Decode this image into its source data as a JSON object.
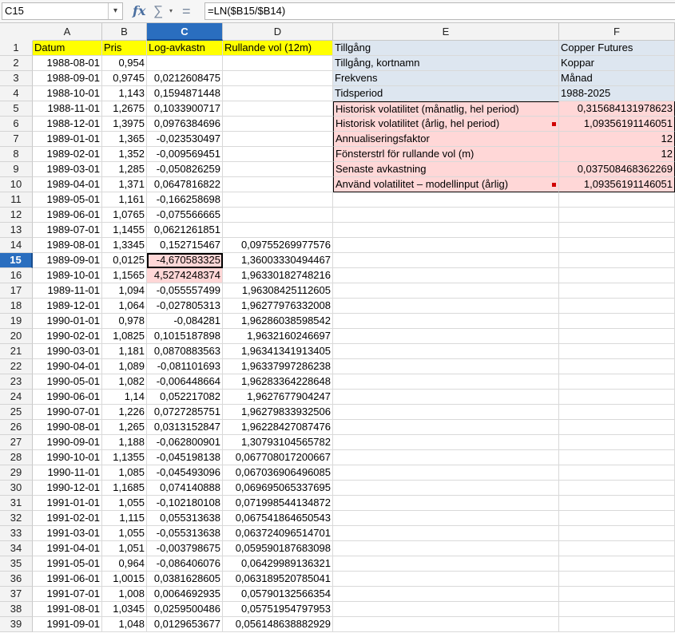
{
  "formula_bar": {
    "cell_ref": "C15",
    "formula": "=LN($B15/$B14)",
    "fx_icon": "fx",
    "sum_icon": "∑",
    "equals_icon": "="
  },
  "columns": [
    "A",
    "B",
    "C",
    "D",
    "E",
    "F"
  ],
  "selected_column": "C",
  "selected_row": "15",
  "header_row": {
    "A": "Datum",
    "B": "Pris",
    "C": "Log-avkastn",
    "D": "Rullande vol (12m)"
  },
  "info": [
    {
      "label": "Tillgång",
      "value": "Copper Futures"
    },
    {
      "label": "Tillgång, kortnamn",
      "value": "Koppar"
    },
    {
      "label": "Frekvens",
      "value": "Månad"
    },
    {
      "label": "Tidsperiod",
      "value": "1988-2025"
    },
    {
      "label": "Historisk volatilitet (månatlig, hel period)",
      "value": "0,315684131978623"
    },
    {
      "label": "Historisk volatilitet (årlig, hel period)",
      "value": "1,09356191146051"
    },
    {
      "label": "Annualiseringsfaktor",
      "value": "12"
    },
    {
      "label": "Fönsterstrl för rullande vol (m)",
      "value": "12"
    },
    {
      "label": "Senaste avkastning",
      "value": "0,037508468362269"
    },
    {
      "label": "Använd volatilitet – modellinput (årlig)",
      "value": "1,09356191146051"
    }
  ],
  "rows": [
    {
      "n": "2",
      "date": "1988-08-01",
      "price": "0,954",
      "ret": "",
      "vol": ""
    },
    {
      "n": "3",
      "date": "1988-09-01",
      "price": "0,9745",
      "ret": "0,0212608475",
      "vol": ""
    },
    {
      "n": "4",
      "date": "1988-10-01",
      "price": "1,143",
      "ret": "0,1594871448",
      "vol": ""
    },
    {
      "n": "5",
      "date": "1988-11-01",
      "price": "1,2675",
      "ret": "0,1033900717",
      "vol": ""
    },
    {
      "n": "6",
      "date": "1988-12-01",
      "price": "1,3975",
      "ret": "0,0976384696",
      "vol": ""
    },
    {
      "n": "7",
      "date": "1989-01-01",
      "price": "1,365",
      "ret": "-0,023530497",
      "vol": ""
    },
    {
      "n": "8",
      "date": "1989-02-01",
      "price": "1,352",
      "ret": "-0,009569451",
      "vol": ""
    },
    {
      "n": "9",
      "date": "1989-03-01",
      "price": "1,285",
      "ret": "-0,050826259",
      "vol": ""
    },
    {
      "n": "10",
      "date": "1989-04-01",
      "price": "1,371",
      "ret": "0,0647816822",
      "vol": ""
    },
    {
      "n": "11",
      "date": "1989-05-01",
      "price": "1,161",
      "ret": "-0,166258698",
      "vol": ""
    },
    {
      "n": "12",
      "date": "1989-06-01",
      "price": "1,0765",
      "ret": "-0,075566665",
      "vol": ""
    },
    {
      "n": "13",
      "date": "1989-07-01",
      "price": "1,1455",
      "ret": "0,0621261851",
      "vol": ""
    },
    {
      "n": "14",
      "date": "1989-08-01",
      "price": "1,3345",
      "ret": "0,152715467",
      "vol": "0,09755269977576"
    },
    {
      "n": "15",
      "date": "1989-09-01",
      "price": "0,0125",
      "ret": "-4,670583325",
      "vol": "1,36003330494467"
    },
    {
      "n": "16",
      "date": "1989-10-01",
      "price": "1,1565",
      "ret": "4,5274248374",
      "vol": "1,96330182748216"
    },
    {
      "n": "17",
      "date": "1989-11-01",
      "price": "1,094",
      "ret": "-0,055557499",
      "vol": "1,96308425112605"
    },
    {
      "n": "18",
      "date": "1989-12-01",
      "price": "1,064",
      "ret": "-0,027805313",
      "vol": "1,96277976332008"
    },
    {
      "n": "19",
      "date": "1990-01-01",
      "price": "0,978",
      "ret": "-0,084281",
      "vol": "1,96286038598542"
    },
    {
      "n": "20",
      "date": "1990-02-01",
      "price": "1,0825",
      "ret": "0,1015187898",
      "vol": "1,9632160246697"
    },
    {
      "n": "21",
      "date": "1990-03-01",
      "price": "1,181",
      "ret": "0,0870883563",
      "vol": "1,96341341913405"
    },
    {
      "n": "22",
      "date": "1990-04-01",
      "price": "1,089",
      "ret": "-0,081101693",
      "vol": "1,96337997286238"
    },
    {
      "n": "23",
      "date": "1990-05-01",
      "price": "1,082",
      "ret": "-0,006448664",
      "vol": "1,96283364228648"
    },
    {
      "n": "24",
      "date": "1990-06-01",
      "price": "1,14",
      "ret": "0,052217082",
      "vol": "1,9627677904247"
    },
    {
      "n": "25",
      "date": "1990-07-01",
      "price": "1,226",
      "ret": "0,0727285751",
      "vol": "1,96279833932506"
    },
    {
      "n": "26",
      "date": "1990-08-01",
      "price": "1,265",
      "ret": "0,0313152847",
      "vol": "1,96228427087476"
    },
    {
      "n": "27",
      "date": "1990-09-01",
      "price": "1,188",
      "ret": "-0,062800901",
      "vol": "1,30793104565782"
    },
    {
      "n": "28",
      "date": "1990-10-01",
      "price": "1,1355",
      "ret": "-0,045198138",
      "vol": "0,067708017200667"
    },
    {
      "n": "29",
      "date": "1990-11-01",
      "price": "1,085",
      "ret": "-0,045493096",
      "vol": "0,067036906496085"
    },
    {
      "n": "30",
      "date": "1990-12-01",
      "price": "1,1685",
      "ret": "0,074140888",
      "vol": "0,069695065337695"
    },
    {
      "n": "31",
      "date": "1991-01-01",
      "price": "1,055",
      "ret": "-0,102180108",
      "vol": "0,071998544134872"
    },
    {
      "n": "32",
      "date": "1991-02-01",
      "price": "1,115",
      "ret": "0,055313638",
      "vol": "0,067541864650543"
    },
    {
      "n": "33",
      "date": "1991-03-01",
      "price": "1,055",
      "ret": "-0,055313638",
      "vol": "0,063724096514701"
    },
    {
      "n": "34",
      "date": "1991-04-01",
      "price": "1,051",
      "ret": "-0,003798675",
      "vol": "0,059590187683098"
    },
    {
      "n": "35",
      "date": "1991-05-01",
      "price": "0,964",
      "ret": "-0,086406076",
      "vol": "0,06429989136321"
    },
    {
      "n": "36",
      "date": "1991-06-01",
      "price": "1,0015",
      "ret": "0,0381628605",
      "vol": "0,063189520785041"
    },
    {
      "n": "37",
      "date": "1991-07-01",
      "price": "1,008",
      "ret": "0,0064692935",
      "vol": "0,05790132566354"
    },
    {
      "n": "38",
      "date": "1991-08-01",
      "price": "1,0345",
      "ret": "0,0259500486",
      "vol": "0,05751954797953"
    },
    {
      "n": "39",
      "date": "1991-09-01",
      "price": "1,048",
      "ret": "0,0129653677",
      "vol": "0,056148638882929"
    }
  ],
  "colors": {
    "header_yellow": "#ffff00",
    "info_blue": "#dde6f0",
    "stat_pink": "#ffd7d7",
    "selection_blue": "#2a6ebf",
    "comment_marker": "#d00000"
  }
}
